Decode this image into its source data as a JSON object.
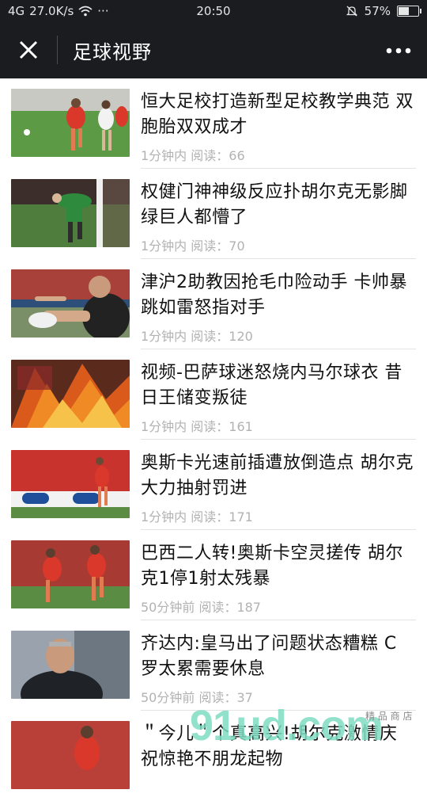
{
  "status_bar": {
    "signal": "4G",
    "speed": "27.0K/s",
    "dots": "···",
    "time": "20:50",
    "battery": "57%",
    "battery_level": 0.57
  },
  "nav": {
    "title": "足球视野"
  },
  "articles": [
    {
      "title": "恒大足校打造新型足校教学典范 双胞胎双双成才",
      "meta": "1分钟内 阅读：66"
    },
    {
      "title": "权健门神神级反应扑胡尔克无影脚 绿巨人都懵了",
      "meta": "1分钟内 阅读：70"
    },
    {
      "title": "津沪2助教因抢毛巾险动手 卡帅暴跳如雷怒指对手",
      "meta": "1分钟内 阅读：120"
    },
    {
      "title": "视频-巴萨球迷怒烧内马尔球衣 昔日王储变叛徒",
      "meta": "1分钟内 阅读：161"
    },
    {
      "title": "奥斯卡光速前插遭放倒造点 胡尔克大力抽射罚进",
      "meta": "1分钟内 阅读：171"
    },
    {
      "title": "巴西二人转!奥斯卡空灵搓传 胡尔克1停1射太残暴",
      "meta": "50分钟前 阅读：187"
    },
    {
      "title": "齐达内:皇马出了问题状态糟糕 C罗太累需要休息",
      "meta": "50分钟前 阅读：37"
    },
    {
      "title": "＂今儿＂个真高兴!胡尔克激情庆祝惊艳不朋龙起物",
      "meta": ""
    }
  ],
  "watermark": {
    "text": "91ud.com",
    "sub": "精 品 商 店"
  }
}
